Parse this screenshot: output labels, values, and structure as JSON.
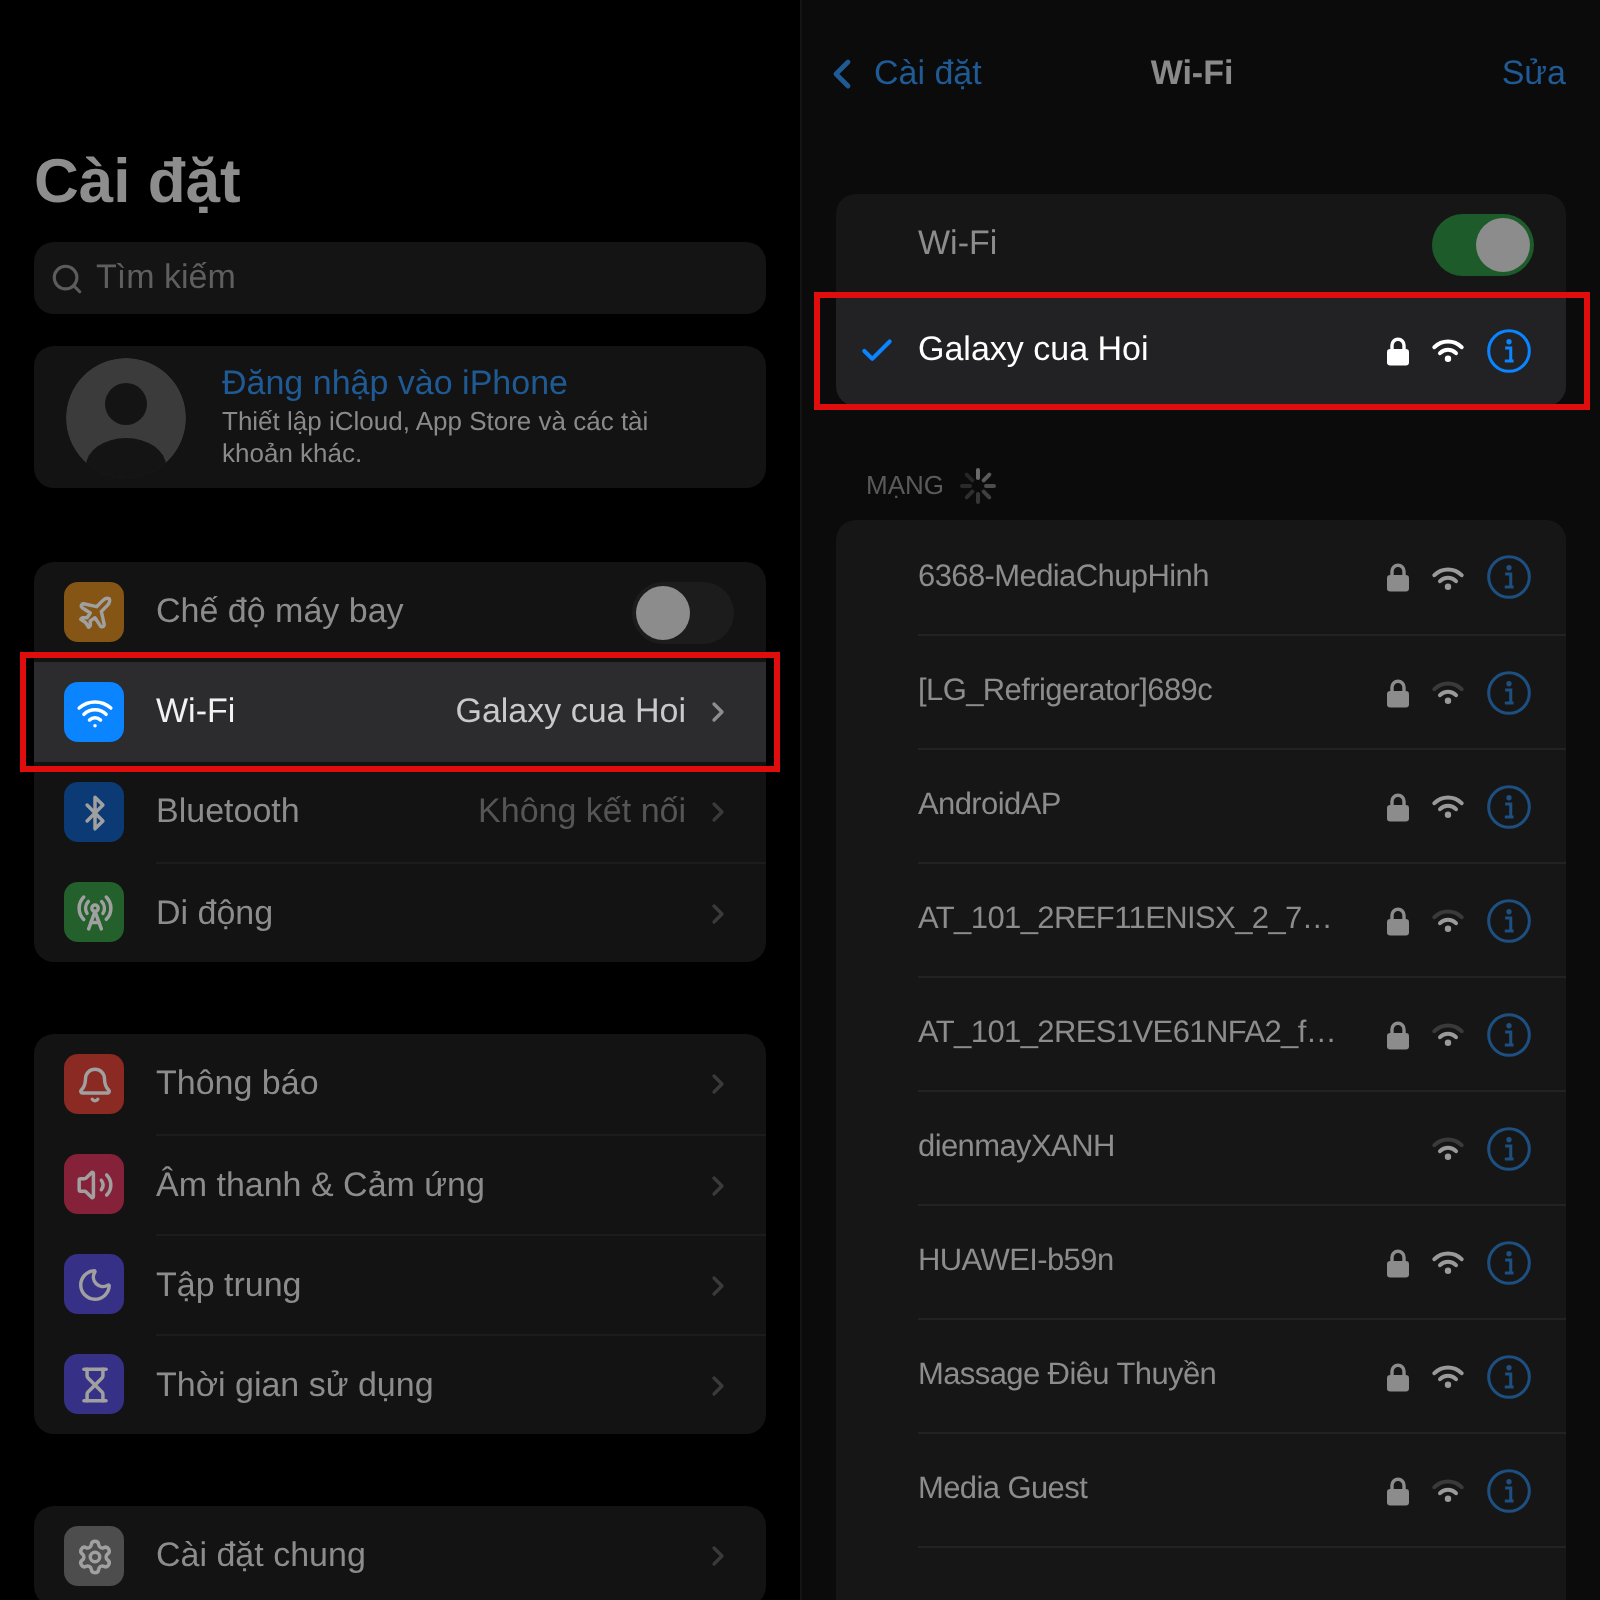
{
  "settings": {
    "title": "Cài đặt",
    "search": {
      "placeholder": "Tìm kiếm"
    },
    "account": {
      "title": "Đăng nhập vào iPhone",
      "subtitle": "Thiết lập iCloud, App Store và các tài khoản khác."
    },
    "groups": [
      {
        "items": [
          {
            "kind": "toggle",
            "label": "Chế độ máy bay",
            "color": "#845515",
            "on": false,
            "highlighted": false
          },
          {
            "kind": "link",
            "label": "Wi-Fi",
            "value": "Galaxy cua Hoi",
            "color": "#0a84ff",
            "highlighted": true
          },
          {
            "kind": "link",
            "label": "Bluetooth",
            "value": "Không kết nối",
            "color": "#0b3a75",
            "highlighted": false
          },
          {
            "kind": "link",
            "label": "Di động",
            "color": "#23602c",
            "highlighted": false
          }
        ]
      },
      {
        "items": [
          {
            "kind": "link",
            "label": "Thông báo",
            "color": "#8a2a22",
            "highlighted": false
          },
          {
            "kind": "link",
            "label": "Âm thanh & Cảm ứng",
            "color": "#86213a",
            "highlighted": false
          },
          {
            "kind": "link",
            "label": "Tập trung",
            "color": "#363087",
            "highlighted": false
          },
          {
            "kind": "link",
            "label": "Thời gian sử dụng",
            "color": "#363087",
            "highlighted": false
          }
        ]
      },
      {
        "items": [
          {
            "kind": "link",
            "label": "Cài đặt chung",
            "color": "#4d4d4d",
            "highlighted": false
          }
        ]
      }
    ]
  },
  "wifi": {
    "back": "Cài đặt",
    "title": "Wi-Fi",
    "edit": "Sửa",
    "toggle": {
      "label": "Wi-Fi",
      "on": true
    },
    "connected": {
      "name": "Galaxy cua Hoi",
      "checked": true,
      "secured": true,
      "full_signal": true,
      "highlighted": true
    },
    "section_header": "MẠNG",
    "networks": [
      {
        "name": "6368-MediaChupHinh",
        "secured": true,
        "full_signal": true
      },
      {
        "name": "[LG_Refrigerator]689c",
        "secured": true,
        "full_signal": false
      },
      {
        "name": "AndroidAP",
        "secured": true,
        "full_signal": true
      },
      {
        "name": "AT_101_2REF11ENISX_2_7…",
        "secured": true,
        "full_signal": false
      },
      {
        "name": "AT_101_2RES1VE61NFA2_f…",
        "secured": true,
        "full_signal": false
      },
      {
        "name": "dienmayXANH",
        "secured": false,
        "full_signal": false
      },
      {
        "name": "HUAWEI-b59n",
        "secured": true,
        "full_signal": true
      },
      {
        "name": "Massage Điêu Thuyền",
        "secured": true,
        "full_signal": true
      },
      {
        "name": "Media Guest",
        "secured": true,
        "full_signal": false
      }
    ]
  }
}
